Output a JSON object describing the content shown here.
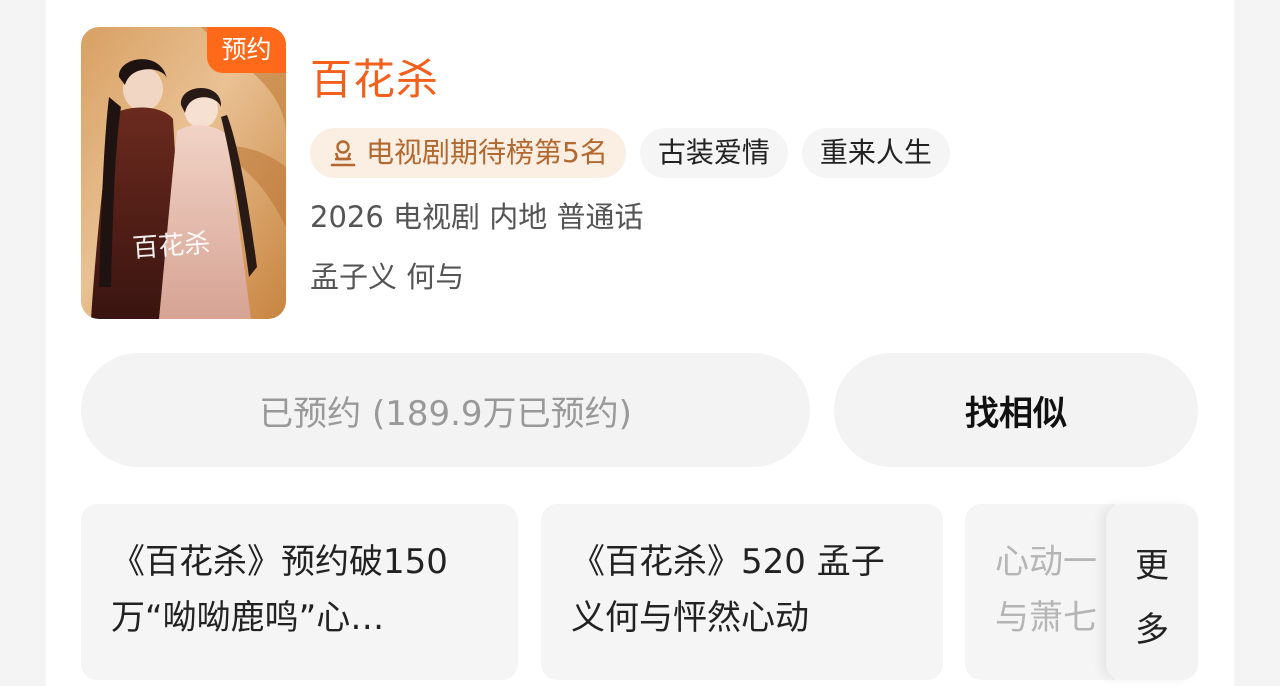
{
  "poster": {
    "badge": "预约",
    "art_title": "百花杀",
    "colors": {
      "badge": "#ff6a1a"
    }
  },
  "show": {
    "title": "百花杀",
    "rank_tag": "电视剧期待榜第5名",
    "tags": [
      "古装爱情",
      "重来人生"
    ],
    "meta": "2026 电视剧 内地 普通话",
    "cast": "孟子义 何与",
    "colors": {
      "title": "#f45f1c",
      "rank_text": "#b2682f",
      "rank_bg": "#fbeee2"
    }
  },
  "actions": {
    "reserved_label": "已预约 (189.9万已预约)",
    "similar_label": "找相似"
  },
  "news": [
    {
      "text": "《百花杀》预约破150万“呦呦鹿鸣”心…"
    },
    {
      "text": "《百花杀》520 孟子义何与怦然心动"
    },
    {
      "text": "心动一与萧七"
    }
  ],
  "more": {
    "line1": "更",
    "line2": "多"
  }
}
